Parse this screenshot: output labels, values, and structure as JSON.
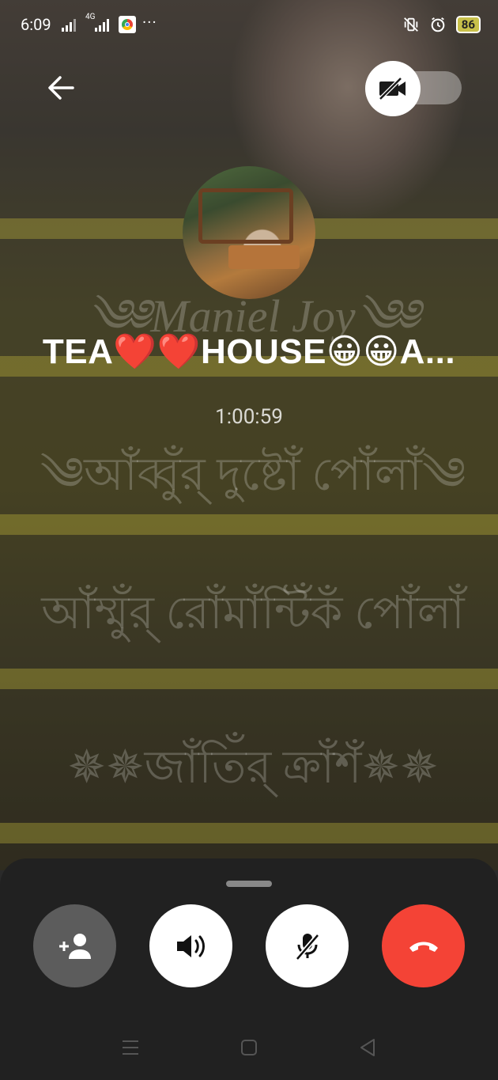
{
  "status_bar": {
    "time": "6:09",
    "network": "4G",
    "more": "···",
    "battery": "86"
  },
  "call": {
    "caller_name": "TEA❤️❤️HOUSE😀😀A...",
    "duration": "1:00:59"
  },
  "background_watermark": {
    "line1": "༄༅Maniel Joy༄༅",
    "line2": "༄আঁব্বুঁর্ দুষ্টোঁ পোঁলাঁ༄",
    "line3": "আঁম্মুঁর্ রোঁমাঁন্টিঁকঁ পোঁলাঁ",
    "line4": "✵✵জাঁতিঁর্ ক্রাঁশঁ✵✵"
  },
  "icons": {
    "back": "arrow-left-icon",
    "video": "video-off-icon",
    "add_person": "add-person-icon",
    "speaker": "speaker-icon",
    "mute": "mic-off-icon",
    "end": "end-call-icon"
  },
  "colors": {
    "end_call": "#f44336",
    "sheet": "#212121",
    "add_button": "#5c5c5c"
  }
}
